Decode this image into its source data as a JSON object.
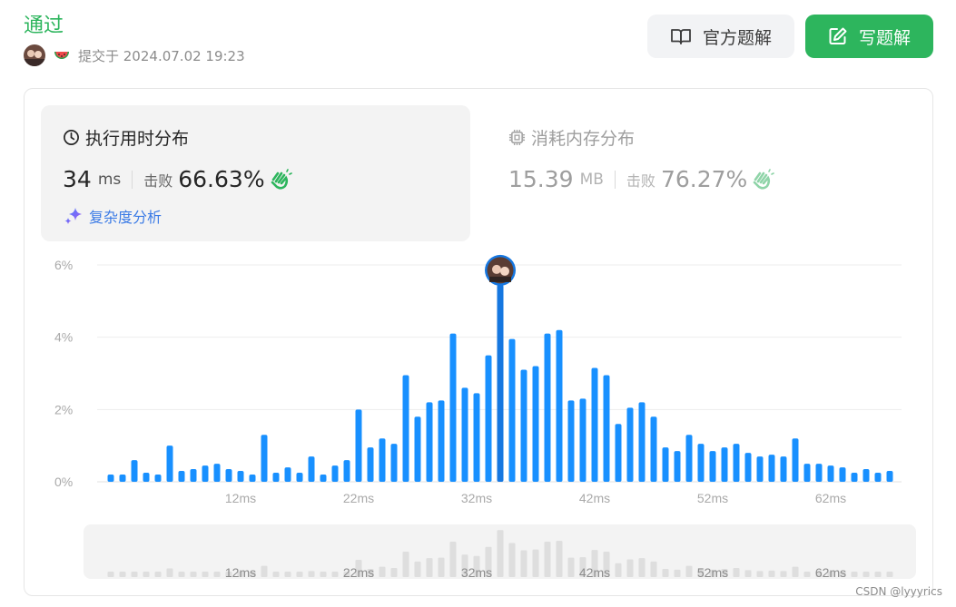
{
  "header": {
    "status": "通过",
    "submitted": "提交于 2024.07.02 19:23",
    "btn_official": "官方题解",
    "btn_write": "写题解",
    "icons": [
      "avatar",
      "watermelon-icon",
      "book-icon",
      "edit-icon"
    ]
  },
  "time_panel": {
    "title": "执行用时分布",
    "value": "34",
    "unit": "ms",
    "beats_label": "击败",
    "beats": "66.63%",
    "analysis": "复杂度分析"
  },
  "memory_panel": {
    "title": "消耗内存分布",
    "value": "15.39",
    "unit": "MB",
    "beats_label": "击败",
    "beats": "76.27%"
  },
  "colors": {
    "accent": "#2db55d",
    "bar": "#1890ff",
    "bar_highlight": "#1677e0",
    "mini_bar": "#dedede"
  },
  "chart_data": {
    "type": "bar",
    "ylim": [
      0,
      6
    ],
    "y_ticks": [
      "6%",
      "4%",
      "2%",
      "0%"
    ],
    "x_ticks": [
      {
        "label": "12ms",
        "value": 12
      },
      {
        "label": "22ms",
        "value": 22
      },
      {
        "label": "32ms",
        "value": 32
      },
      {
        "label": "42ms",
        "value": 42
      },
      {
        "label": "52ms",
        "value": 52
      },
      {
        "label": "62ms",
        "value": 62
      }
    ],
    "x_start": 1,
    "x_end": 68,
    "highlight_x": 34,
    "values": [
      0.2,
      0.2,
      0.6,
      0.25,
      0.2,
      1.0,
      0.3,
      0.35,
      0.45,
      0.5,
      0.35,
      0.3,
      0.2,
      1.3,
      0.25,
      0.4,
      0.25,
      0.7,
      0.2,
      0.45,
      0.6,
      2.0,
      0.95,
      1.2,
      1.05,
      2.95,
      1.8,
      2.2,
      2.25,
      4.1,
      2.6,
      2.45,
      3.5,
      5.45,
      3.95,
      3.1,
      3.2,
      4.1,
      4.2,
      2.25,
      2.3,
      3.15,
      2.95,
      1.6,
      2.05,
      2.2,
      1.8,
      0.95,
      0.85,
      1.3,
      1.05,
      0.85,
      0.95,
      1.05,
      0.8,
      0.7,
      0.75,
      0.7,
      1.2,
      0.5,
      0.5,
      0.45,
      0.4,
      0.25,
      0.35,
      0.25,
      0.3
    ]
  },
  "watermark": "CSDN @lyyyrics"
}
